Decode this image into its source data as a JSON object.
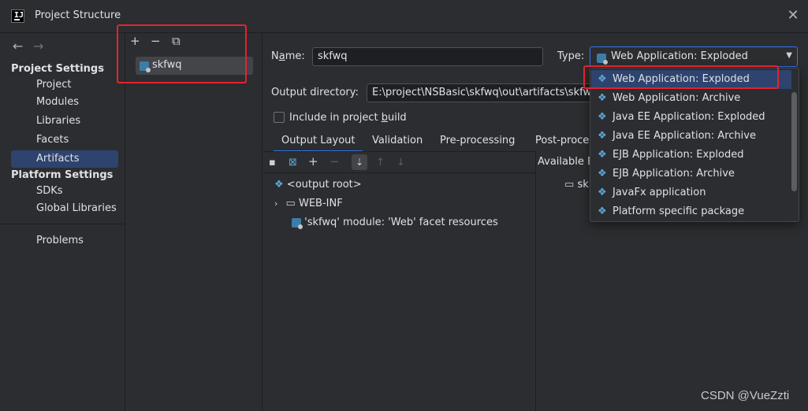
{
  "window": {
    "title": "Project Structure",
    "close": "✕"
  },
  "nav": {
    "back": "←",
    "forward": "→",
    "project_settings_header": "Project Settings",
    "project_settings_items": [
      "Project",
      "Modules",
      "Libraries",
      "Facets",
      "Artifacts"
    ],
    "platform_settings_header": "Platform Settings",
    "platform_settings_items": [
      "SDKs",
      "Global Libraries"
    ],
    "problems": "Problems",
    "selected": "Artifacts"
  },
  "artifact_list": {
    "toolbar": {
      "add": "+",
      "remove": "−",
      "copy": "⧉"
    },
    "items": [
      "skfwq"
    ]
  },
  "form": {
    "name_label_prefix": "N",
    "name_label_mnemonic": "a",
    "name_label_suffix": "me:",
    "name_value": "skfwq",
    "type_label": "Type:",
    "type_value": "Web Application: Exploded",
    "output_dir_label": "Output directory:",
    "output_dir_value": "E:\\project\\NSBasic\\skfwq\\out\\artifacts\\skfwq",
    "include_build_prefix": "Include in project ",
    "include_build_mnemonic": "b",
    "include_build_suffix": "uild",
    "include_build_checked": false
  },
  "tabs": [
    "Output Layout",
    "Validation",
    "Pre-processing",
    "Post-proce"
  ],
  "active_tab": "Output Layout",
  "layout_tree": {
    "root": "<output root>",
    "folder": "WEB-INF",
    "resource": "'skfwq' module: 'Web' facet resources"
  },
  "available": {
    "label": "Available E",
    "item": "sk"
  },
  "type_dropdown": {
    "options": [
      {
        "label": "Web Application: Exploded",
        "icon": "web-module-icon"
      },
      {
        "label": "Web Application: Archive",
        "icon": "web-module-icon"
      },
      {
        "label": "Java EE Application: Exploded",
        "icon": "javaee-icon"
      },
      {
        "label": "Java EE Application: Archive",
        "icon": "javaee-icon"
      },
      {
        "label": "EJB Application: Exploded",
        "icon": "ejb-icon"
      },
      {
        "label": "EJB Application: Archive",
        "icon": "ejb-icon"
      },
      {
        "label": "JavaFx application",
        "icon": "diamond-icon"
      },
      {
        "label": "Platform specific package",
        "icon": "diamond-icon"
      }
    ],
    "selected_index": 0
  },
  "watermark": "CSDN @VueZzti",
  "colors": {
    "accent": "#3574f0",
    "selection": "#2e436e",
    "highlight_box": "#e4232e"
  }
}
